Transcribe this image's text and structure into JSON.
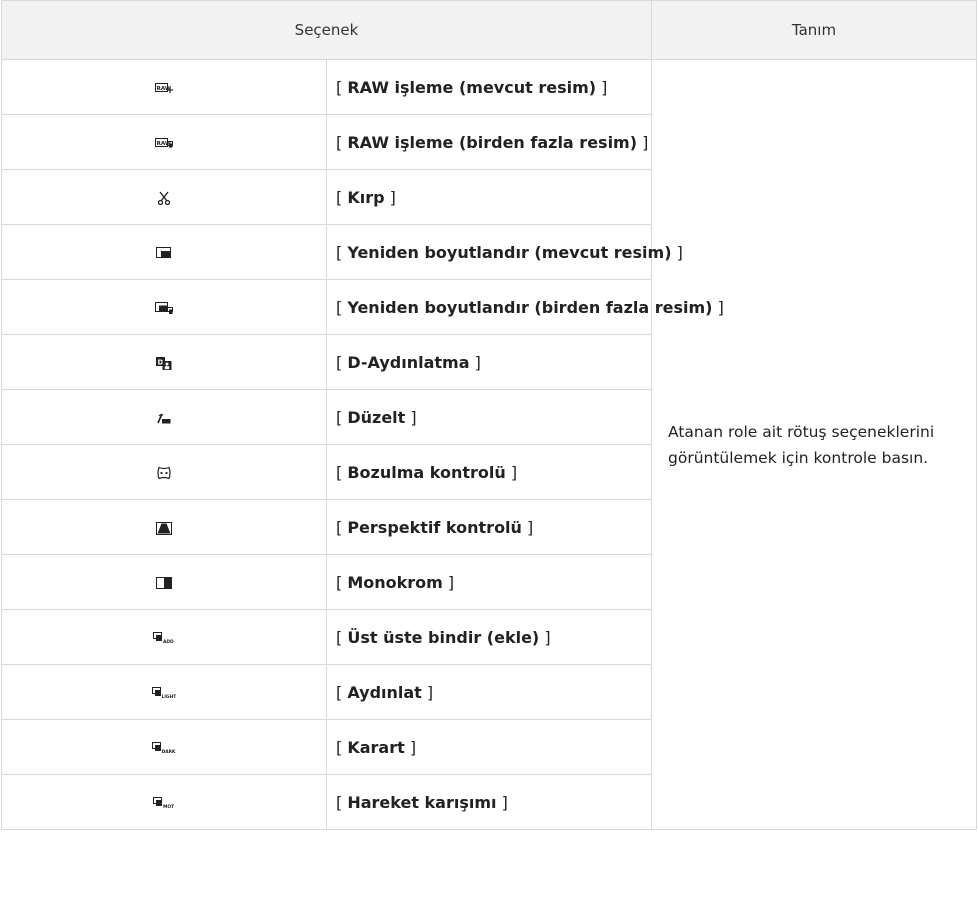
{
  "table": {
    "headers": {
      "option": "Seçenek",
      "description": "Tanım"
    },
    "description": "Atanan role ait rötuş seçeneklerini görüntülemek için kontrole basın.",
    "rows": [
      {
        "icon": "raw-processing-current-icon",
        "label": "RAW işleme (mevcut resim)"
      },
      {
        "icon": "raw-processing-multiple-icon",
        "label": "RAW işleme (birden fazla resim)"
      },
      {
        "icon": "scissors-crop-icon",
        "label": "Kırp"
      },
      {
        "icon": "resize-current-icon",
        "label": "Yeniden boyutlandır (mevcut resim)"
      },
      {
        "icon": "resize-multiple-icon",
        "label": "Yeniden boyutlandır (birden fazla resim)"
      },
      {
        "icon": "d-lighting-icon",
        "label": "D-Aydınlatma"
      },
      {
        "icon": "straighten-icon",
        "label": "Düzelt"
      },
      {
        "icon": "distortion-control-icon",
        "label": "Bozulma kontrolü"
      },
      {
        "icon": "perspective-control-icon",
        "label": "Perspektif kontrolü"
      },
      {
        "icon": "monochrome-icon",
        "label": "Monokrom"
      },
      {
        "icon": "overlay-add-icon",
        "label": "Üst üste bindir (ekle)"
      },
      {
        "icon": "overlay-lighten-icon",
        "label": "Aydınlat"
      },
      {
        "icon": "overlay-darken-icon",
        "label": "Karart"
      },
      {
        "icon": "motion-blend-icon",
        "label": "Hareket karışımı"
      }
    ]
  }
}
